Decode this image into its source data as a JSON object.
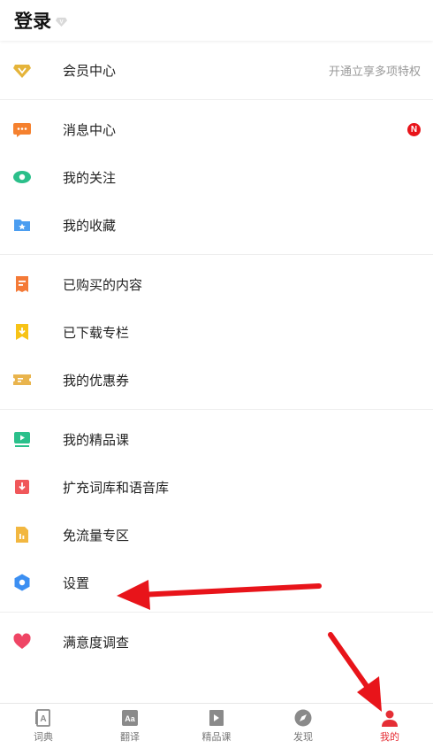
{
  "header": {
    "title": "登录",
    "vip_badge_letter": "V"
  },
  "sections": [
    {
      "items": [
        {
          "id": "member-center",
          "label": "会员中心",
          "icon": "diamond-icon",
          "color": "#e5b43a",
          "right": "开通立享多项特权"
        }
      ]
    },
    {
      "items": [
        {
          "id": "message-center",
          "label": "消息中心",
          "icon": "chat-bubble-icon",
          "color": "#f5812f",
          "badge": "N"
        },
        {
          "id": "my-follows",
          "label": "我的关注",
          "icon": "eye-icon",
          "color": "#2bbf8a"
        },
        {
          "id": "my-favorites",
          "label": "我的收藏",
          "icon": "star-folder-icon",
          "color": "#4b9df0"
        }
      ]
    },
    {
      "items": [
        {
          "id": "purchased-content",
          "label": "已购买的内容",
          "icon": "receipt-icon",
          "color": "#f47a37"
        },
        {
          "id": "downloaded-columns",
          "label": "已下载专栏",
          "icon": "download-icon",
          "color": "#f7c316"
        },
        {
          "id": "my-coupons",
          "label": "我的优惠券",
          "icon": "ticket-icon",
          "color": "#e9b44d"
        }
      ]
    },
    {
      "items": [
        {
          "id": "my-courses",
          "label": "我的精品课",
          "icon": "video-play-icon",
          "color": "#2bc08b"
        },
        {
          "id": "expand-libraries",
          "label": "扩充词库和语音库",
          "icon": "download-box-icon",
          "color": "#f0575a"
        },
        {
          "id": "free-data-zone",
          "label": "免流量专区",
          "icon": "data-file-icon",
          "color": "#f2b740"
        },
        {
          "id": "settings",
          "label": "设置",
          "icon": "hexagon-settings-icon",
          "color": "#3c8ff2"
        }
      ]
    },
    {
      "items": [
        {
          "id": "satisfaction-survey",
          "label": "满意度调查",
          "icon": "heart-icon",
          "color": "#ef4565"
        }
      ]
    }
  ],
  "tabs": [
    {
      "id": "dictionary",
      "label": "词典",
      "icon": "dictionary-icon",
      "active": false
    },
    {
      "id": "translate",
      "label": "翻译",
      "icon": "translate-icon",
      "active": false
    },
    {
      "id": "courses",
      "label": "精品课",
      "icon": "course-play-icon",
      "active": false
    },
    {
      "id": "discover",
      "label": "发现",
      "icon": "compass-icon",
      "active": false
    },
    {
      "id": "me",
      "label": "我的",
      "icon": "person-icon",
      "active": true
    }
  ],
  "colors": {
    "accent": "#e52e35",
    "inactive_tab": "#777777",
    "annotation_arrow": "#e8141a"
  }
}
